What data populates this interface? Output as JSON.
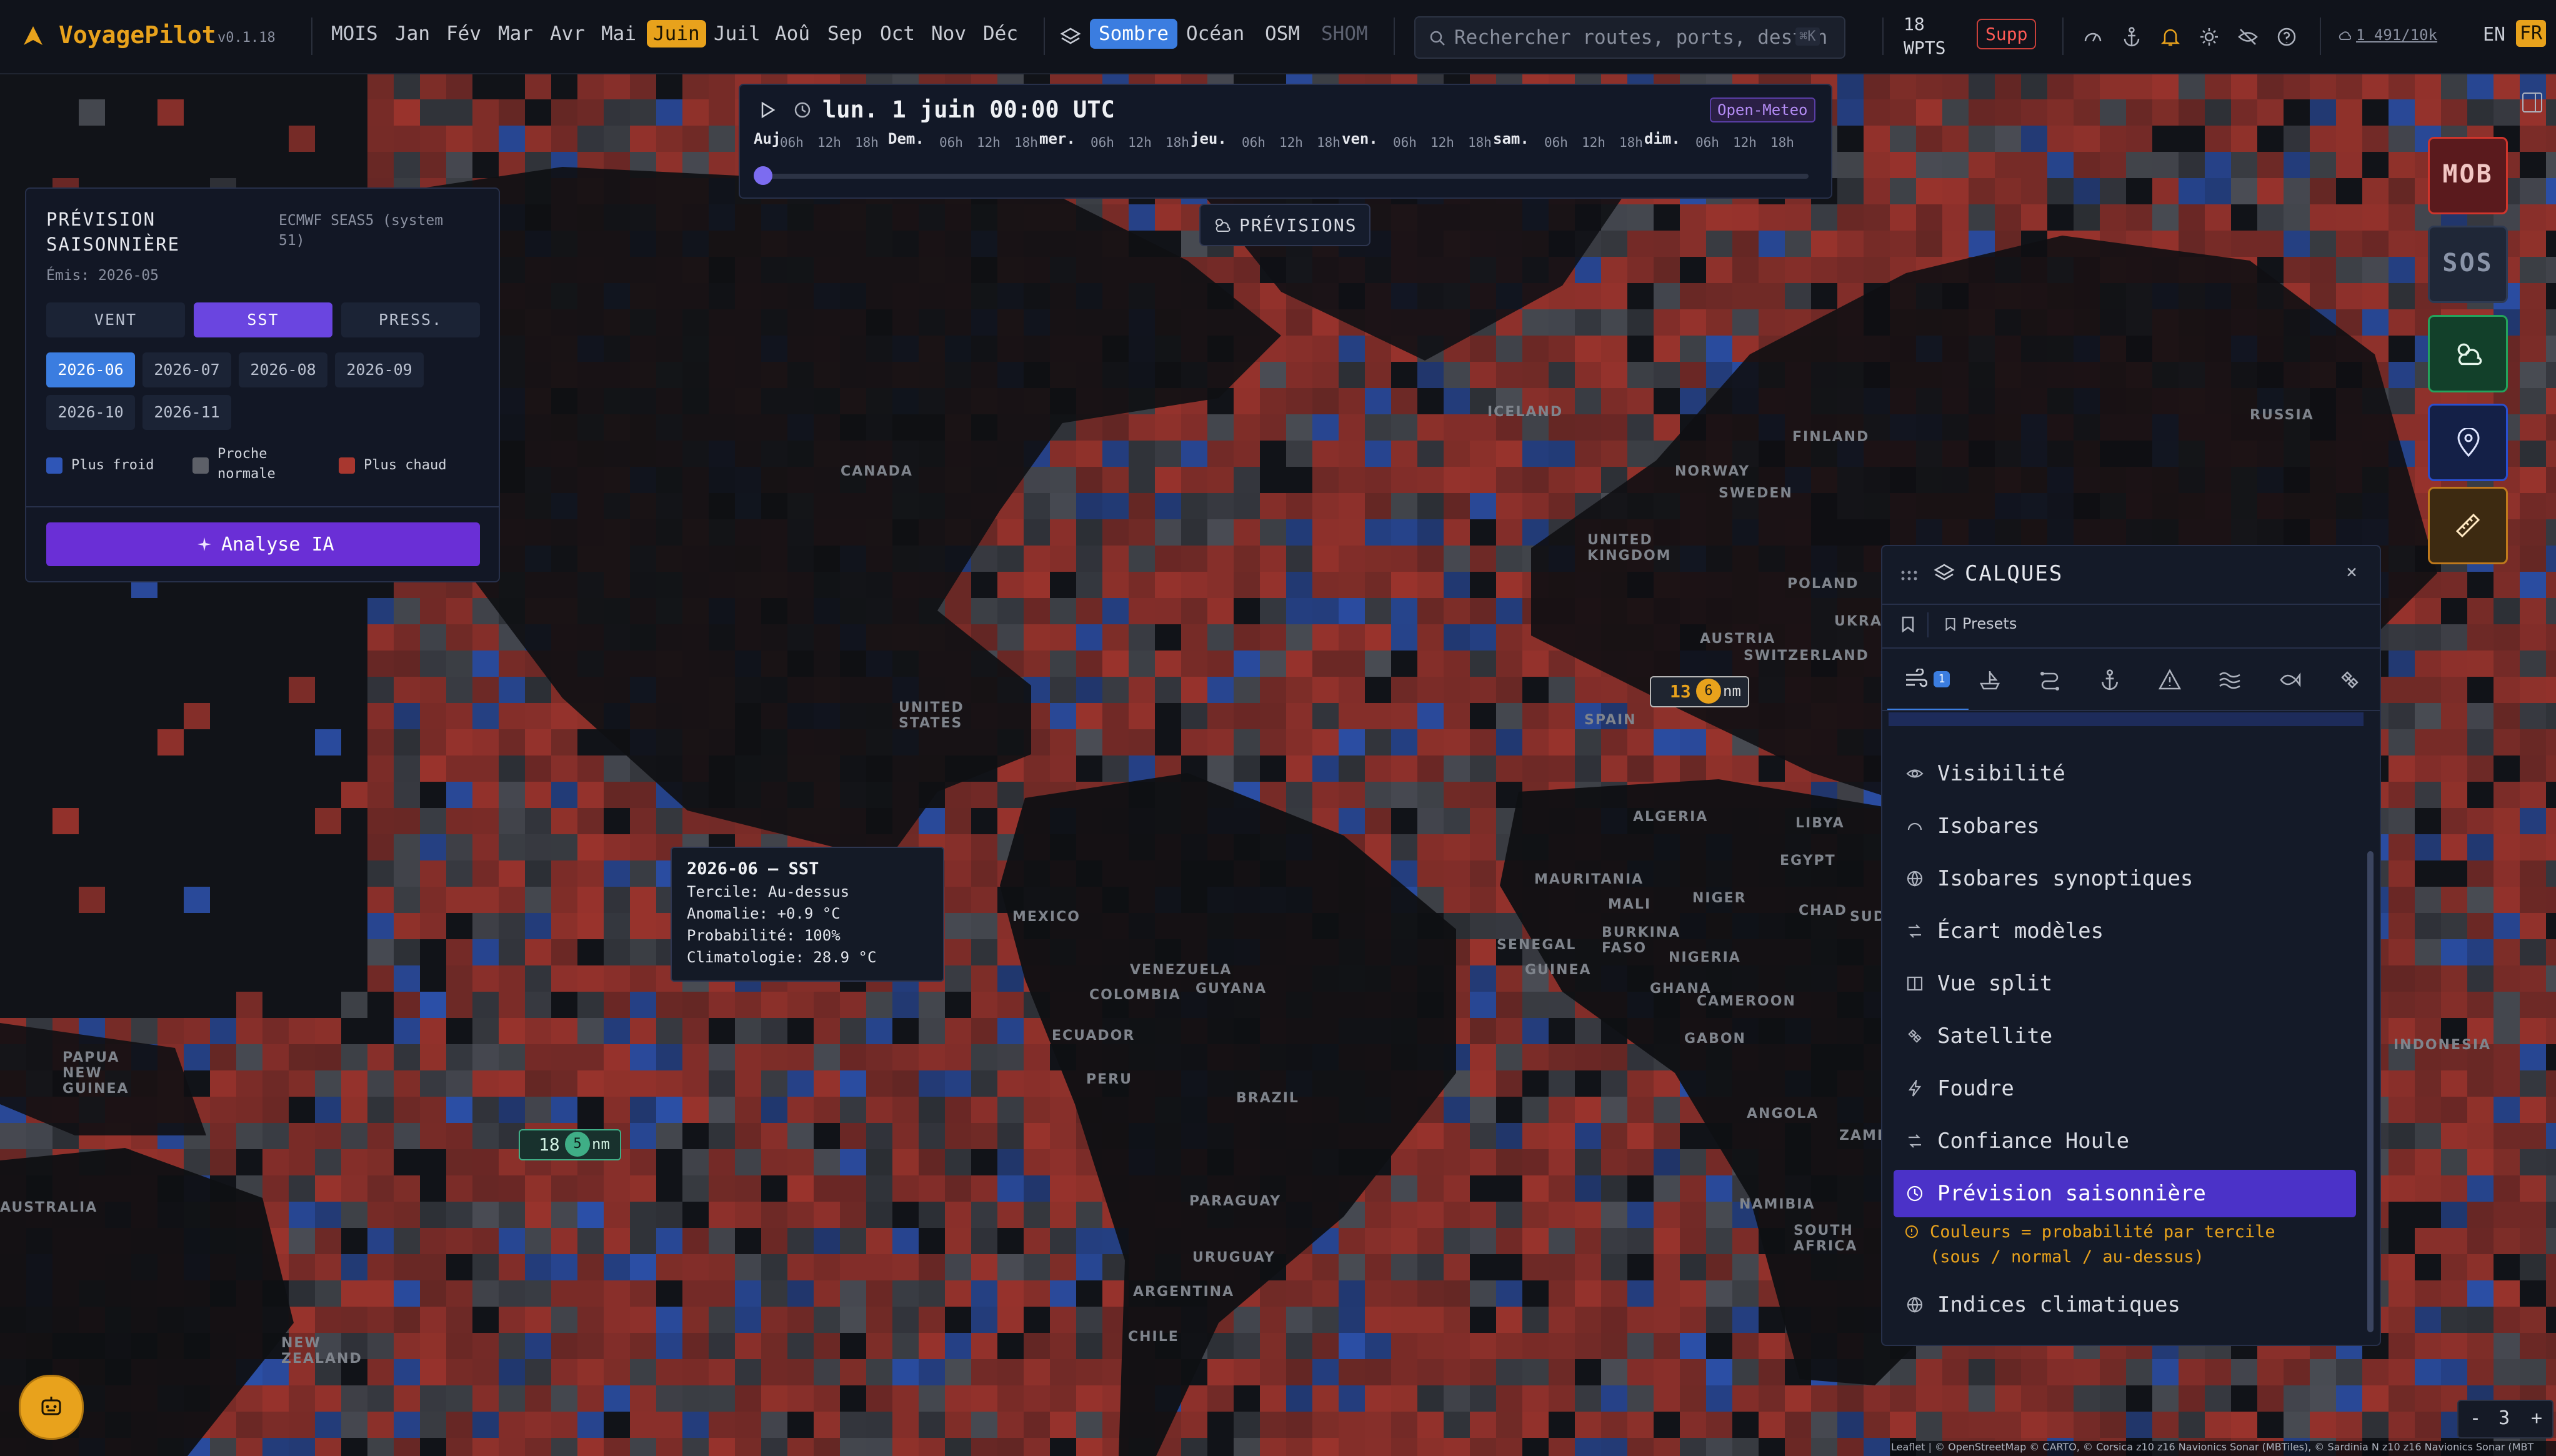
{
  "app": {
    "name": "VoyagePilot",
    "version": "v0.1.18"
  },
  "topbar": {
    "months_label": "MOIS",
    "months": [
      "Jan",
      "Fév",
      "Mar",
      "Avr",
      "Mai",
      "Juin",
      "Juil",
      "Aoû",
      "Sep",
      "Oct",
      "Nov",
      "Déc"
    ],
    "active_month": "Juin",
    "basemaps": [
      "Sombre",
      "Océan",
      "OSM",
      "SHOM"
    ],
    "active_basemap": "Sombre",
    "search_placeholder": "Rechercher routes, ports, destin",
    "search_shortcut": "⌘K",
    "waypoints_count": "18",
    "waypoints_label": "WPTS",
    "delete_label": "Supp",
    "quota": "1 491/10k",
    "lang_en": "EN",
    "lang_fr": "FR"
  },
  "timeline": {
    "current": "lun. 1 juin 00:00 UTC",
    "source": "Open-Meteo",
    "today_label": "Auj",
    "days": [
      "Dem.",
      "mer.",
      "jeu.",
      "ven.",
      "sam.",
      "dim."
    ],
    "hours": [
      "06h",
      "12h",
      "18h"
    ]
  },
  "forecast_button": "PRÉVISIONS",
  "seasonal_panel": {
    "title_line1": "PRÉVISION",
    "title_line2": "SAISONNIÈRE",
    "model_line1": "ECMWF SEAS5 (system",
    "model_line2": "51)",
    "issued": "Émis: 2026-05",
    "vars": [
      "VENT",
      "SST",
      "PRESS."
    ],
    "active_var": "SST",
    "months": [
      "2026-06",
      "2026-07",
      "2026-08",
      "2026-09",
      "2026-10",
      "2026-11"
    ],
    "active_month": "2026-06",
    "legend": {
      "cold": "Plus froid",
      "normal_line1": "Proche",
      "normal_line2": "normale",
      "warm": "Plus chaud"
    },
    "ai_button": "Analyse IA"
  },
  "tooltip": {
    "title": "2026-06 — SST",
    "tercile": "Tercile: Au-dessus",
    "anomaly": "Anomalie: +0.9 °C",
    "probability": "Probabilité: 100%",
    "climatology": "Climatologie: 28.9 °C"
  },
  "map_labels": [
    "ICELAND",
    "FINLAND",
    "RUSSIA",
    "NORWAY",
    "SWEDEN",
    "UNITED KINGDOM",
    "POLAND",
    "UKRAINE",
    "CANADA",
    "UNITED STATES",
    "AUSTRIA",
    "SPAIN",
    "ALGERIA",
    "LIBYA",
    "EGYPT",
    "MAURITANIA",
    "MALI",
    "NIGER",
    "CHAD",
    "SUDAN",
    "SENEGAL",
    "BURKINA FASO",
    "NIGERIA",
    "GUINEA",
    "CAMEROON",
    "GABON",
    "ANGOLA",
    "ZAMBIA",
    "NAMIBIA",
    "SOUTH AFRICA",
    "VENEZUELA",
    "GUYANA",
    "COLOMBIA",
    "ECUADOR",
    "PERU",
    "BRAZIL",
    "PARAGUAY",
    "URUGUAY",
    "ARGENTINA",
    "PAPUA NEW GUINEA",
    "AUSTRALIA",
    "NEW ZEALAND",
    "CHILE",
    "GHANA",
    "MEXICO",
    "INDONESIA",
    "SWITZERLAND"
  ],
  "clusters": [
    {
      "text": "13",
      "count": "6",
      "suffix": "nm"
    },
    {
      "text": "18",
      "count": "5",
      "suffix": "nm"
    }
  ],
  "layers_panel": {
    "title": "CALQUES",
    "presets": "Presets",
    "tab_badge": "1",
    "items": [
      "Visibilité",
      "Isobares",
      "Isobares synoptiques",
      "Écart modèles",
      "Vue split",
      "Satellite",
      "Foudre",
      "Confiance Houle",
      "Prévision saisonnière",
      "Indices climatiques"
    ],
    "active_item": "Prévision saisonnière",
    "note_line1": "Couleurs = probabilité par tercile",
    "note_line2": "(sous / normal / au-dessus)"
  },
  "side_buttons": {
    "mob": "MOB",
    "sos": "SOS"
  },
  "zoom": {
    "minus": "-",
    "level": "3",
    "plus": "+"
  },
  "attribution": "Leaflet | © OpenStreetMap © CARTO, © Corsica z10 z16 Navionics Sonar (MBTiles), © Sardinia N z10 z16 Navionics Sonar (MBT",
  "colors": {
    "accent": "#e8a21c",
    "cold": "#2f56b7",
    "normal": "#5d6068",
    "warm": "#a8372f",
    "active_layer": "#4b32c8",
    "ai_button": "#6a2fd6",
    "mob": "#d0352c",
    "weather_btn": "#23a35c",
    "pin_btn": "#2a4fd0",
    "ruler_btn": "#c07a1c"
  }
}
